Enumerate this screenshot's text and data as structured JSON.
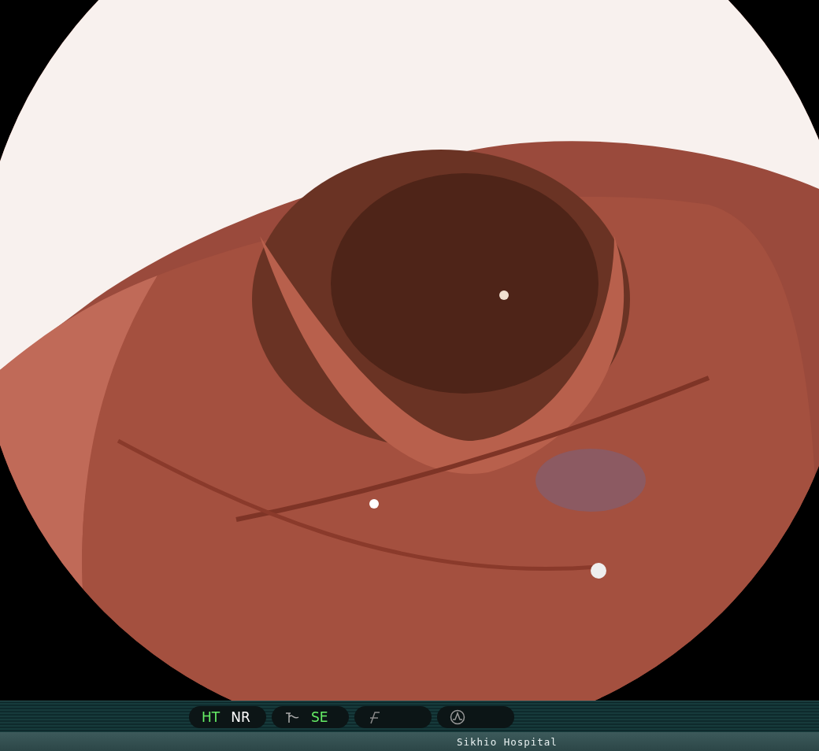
{
  "indicator_groups": [
    {
      "kind": "text",
      "items": [
        {
          "label": "HT",
          "on": true
        },
        {
          "label": "NR",
          "on": false
        }
      ]
    },
    {
      "kind": "curve",
      "items": [
        {
          "label": "SE",
          "on": true
        }
      ]
    },
    {
      "kind": "filter"
    },
    {
      "kind": "waveform"
    }
  ],
  "status_bar": {
    "institution": "Sikhio Hospital"
  }
}
